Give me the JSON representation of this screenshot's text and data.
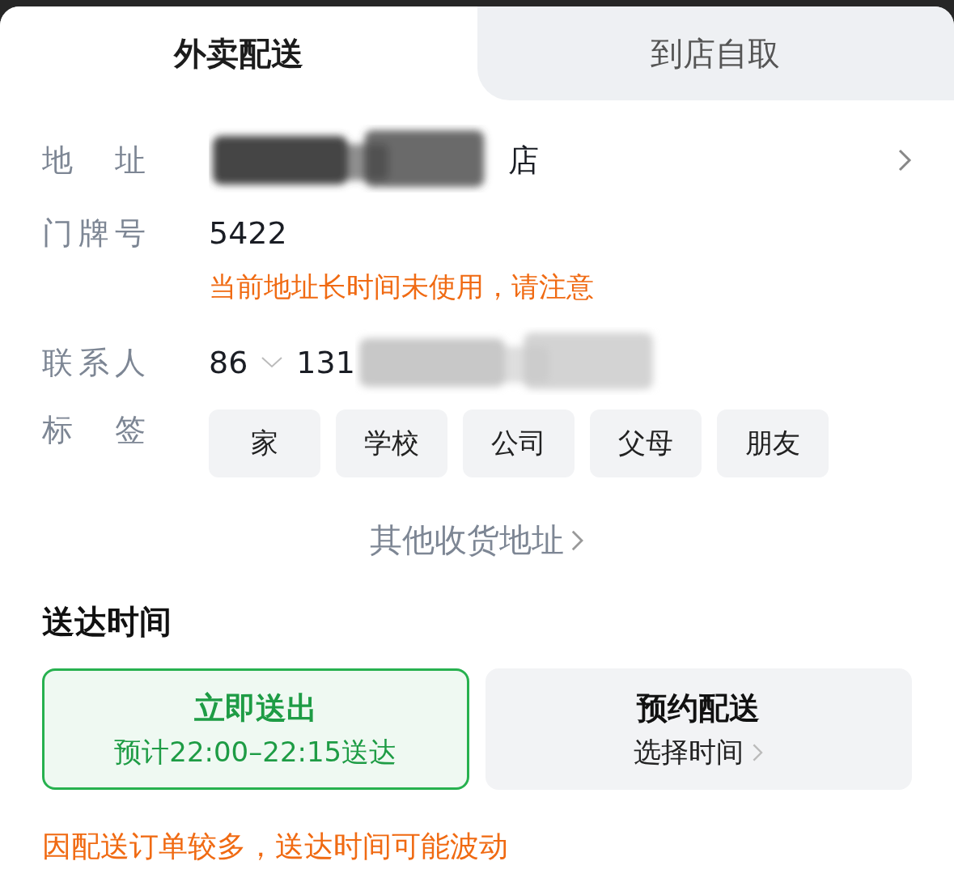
{
  "tabs": [
    {
      "label": "外卖配送",
      "selected": true
    },
    {
      "label": "到店自取",
      "selected": false
    }
  ],
  "address": {
    "label": "地 址",
    "value": "店"
  },
  "house_number": {
    "label": "门牌号",
    "value": "5422",
    "warning": "当前地址长时间未使用，请注意"
  },
  "contact": {
    "label": "联系人",
    "country_code": "86",
    "phone": "131"
  },
  "tags": {
    "label": "标 签",
    "items": [
      {
        "label": "家",
        "selected": false
      },
      {
        "label": "学校",
        "selected": false
      },
      {
        "label": "公司",
        "selected": false
      },
      {
        "label": "父母",
        "selected": false
      },
      {
        "label": "朋友",
        "selected": false
      }
    ]
  },
  "other_addresses": "其他收货地址",
  "delivery_time": {
    "title": "送达时间",
    "options": [
      {
        "title": "立即送出",
        "subtitle": "预计22:00–22:15送达",
        "selected": true,
        "has_chevron": false
      },
      {
        "title": "预约配送",
        "subtitle": "选择时间",
        "selected": false,
        "has_chevron": true
      }
    ],
    "notice": "因配送订单较多，送达时间可能波动"
  }
}
